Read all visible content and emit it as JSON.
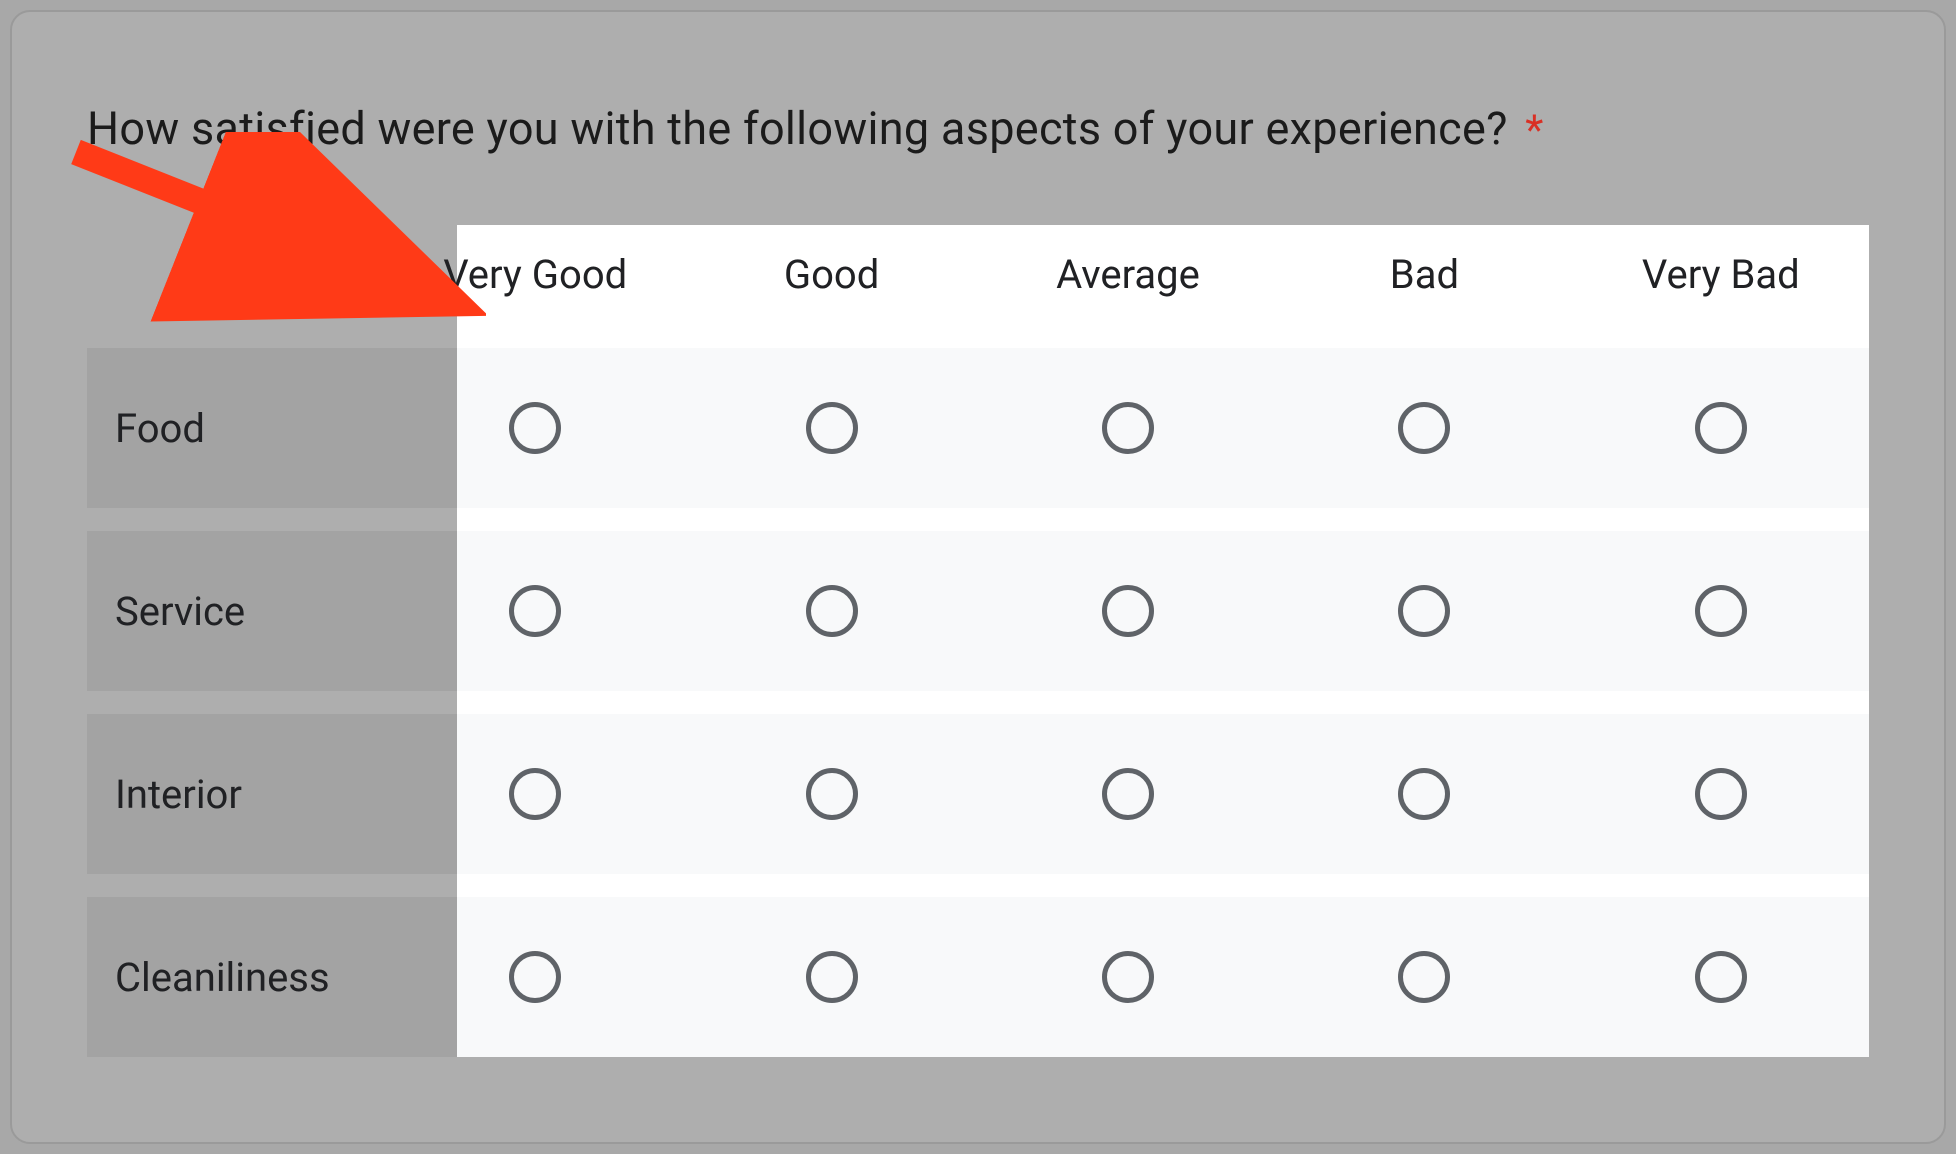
{
  "question": {
    "title": "How satisfied were you with the following aspects of your experience?",
    "required_marker": "*"
  },
  "columns": [
    "Very Good",
    "Good",
    "Average",
    "Bad",
    "Very Bad"
  ],
  "rows": [
    "Food",
    "Service",
    "Interior",
    "Cleaniliness"
  ],
  "annotation": {
    "arrow_target": "column-headers",
    "arrow_color": "#ff3a17"
  }
}
